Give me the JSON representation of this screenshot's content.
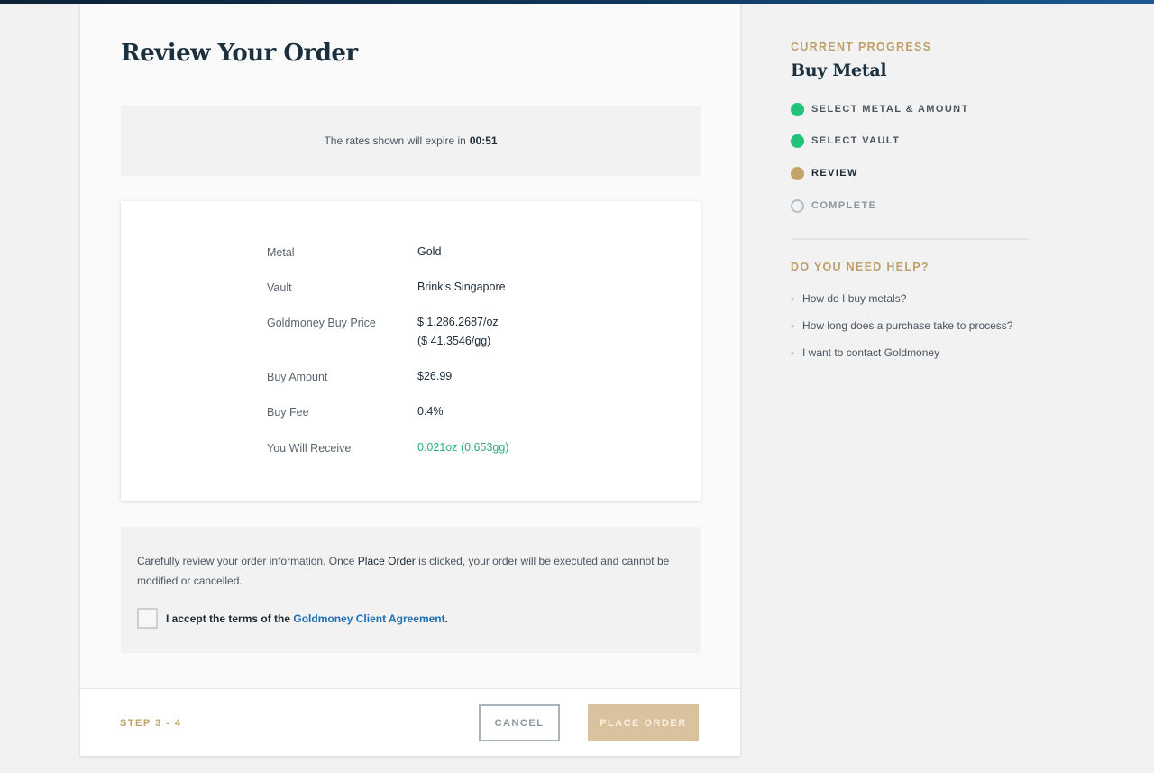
{
  "main": {
    "title": "Review Your Order",
    "rate_notice": {
      "text": "The rates shown will expire in",
      "timer": "00:51"
    },
    "details": [
      {
        "label": "Metal",
        "value": "Gold",
        "value2": ""
      },
      {
        "label": "Vault",
        "value": "Brink's Singapore",
        "value2": ""
      },
      {
        "label": "Goldmoney Buy Price",
        "value": "$ 1,286.2687/oz",
        "value2": "($ 41.3546/gg)"
      },
      {
        "label": "Buy Amount",
        "value": "$26.99",
        "value2": ""
      },
      {
        "label": "Buy Fee",
        "value": "0.4%",
        "value2": ""
      },
      {
        "label": "You Will Receive",
        "value": "0.021oz (0.653gg)",
        "value2": ""
      }
    ],
    "notice": {
      "prefix": "Carefully review your order information. Once",
      "emphasis": "Place Order",
      "suffix": "is clicked, your order will be executed and cannot be modified or cancelled."
    },
    "accept": {
      "prefix": "I accept the terms of the",
      "link": "Goldmoney Client Agreement",
      "suffix": ".",
      "checked": false
    },
    "footer": {
      "step": "STEP 3 - 4",
      "cancel_label": "CANCEL",
      "place_order_label": "PLACE ORDER"
    }
  },
  "sidebar": {
    "progress_heading": "CURRENT PROGRESS",
    "progress_title": "Buy Metal",
    "steps": [
      {
        "label": "SELECT METAL & AMOUNT",
        "status": "done"
      },
      {
        "label": "SELECT VAULT",
        "status": "done"
      },
      {
        "label": "REVIEW",
        "status": "current"
      },
      {
        "label": "COMPLETE",
        "status": "todo"
      }
    ],
    "help_heading": "DO YOU NEED HELP?",
    "help_links": [
      "How do I buy metals?",
      "How long does a purchase take to process?",
      "I want to contact Goldmoney"
    ]
  },
  "colors": {
    "accent_gold": "#c0a06a",
    "done_green": "#20c178",
    "current_gold": "#c3a46b",
    "link_blue": "#1f6fb5",
    "receive_green": "#2cae78"
  }
}
